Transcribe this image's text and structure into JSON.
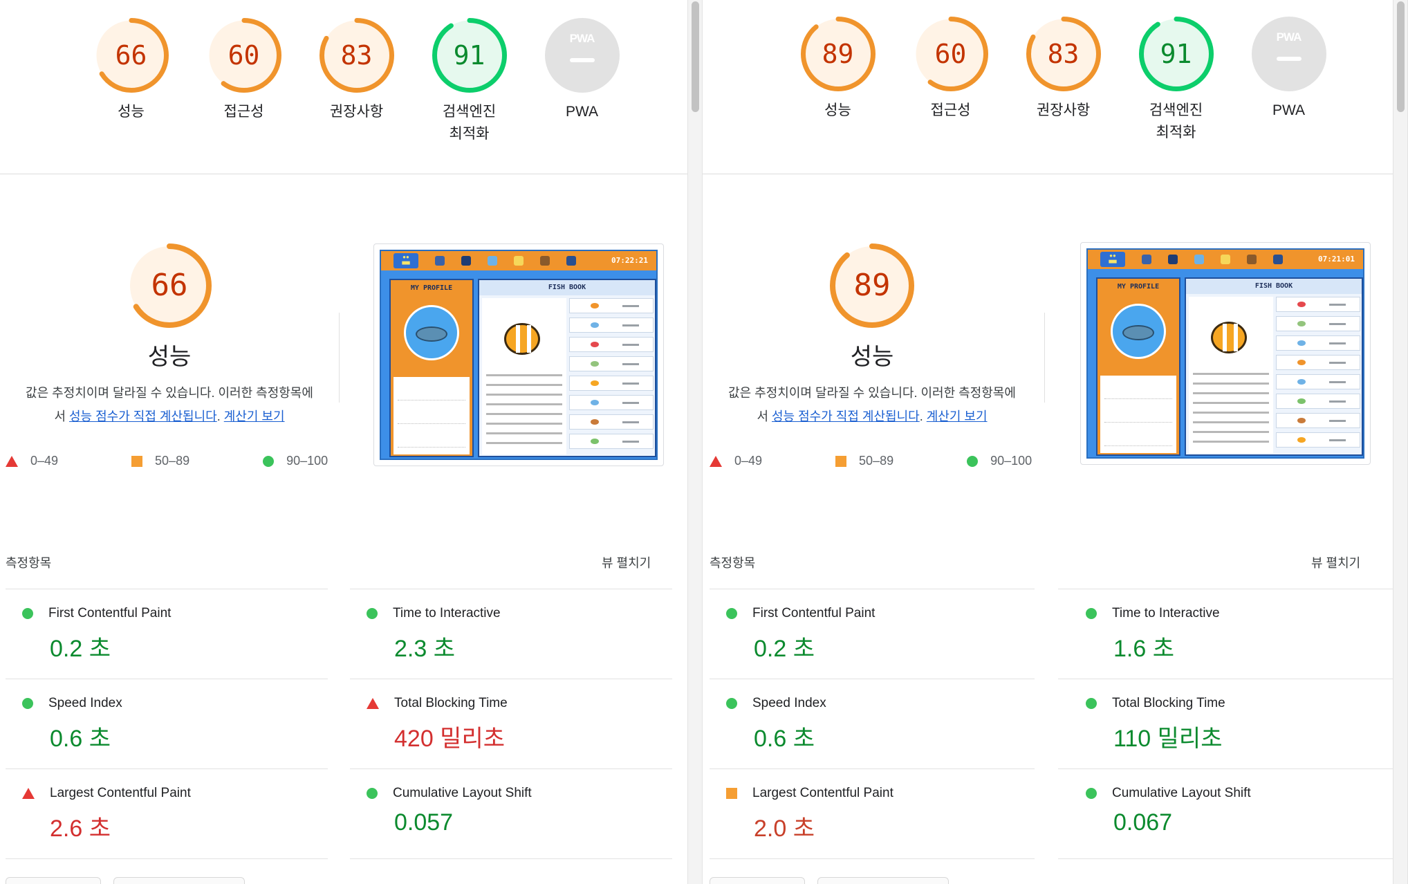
{
  "colors": {
    "orange": "#f0942c",
    "orange_text": "#c33300",
    "green": "#0cce6b",
    "green_text": "#0b8a2e",
    "red": "#e53935",
    "pwa_gray": "#e2e2e2",
    "link": "#1a5fd1"
  },
  "legend": {
    "fail": "0–49",
    "average": "50–89",
    "pass": "90–100"
  },
  "reports": [
    {
      "id": "before",
      "categories": [
        {
          "label": "성능",
          "score": 66
        },
        {
          "label": "접근성",
          "score": 60
        },
        {
          "label": "권장사항",
          "score": 83
        },
        {
          "label": "검색엔진",
          "label2": "최적화",
          "score": 91
        },
        {
          "label": "PWA",
          "score": null,
          "badge": "PWA"
        }
      ],
      "perf_score": 66,
      "perf_title": "성능",
      "desc_line1": "값은 추정치이며 달라질 수 있습니다. 이러한 측정항목에",
      "desc_prefix": "서 ",
      "desc_link1": "성능 점수가 직접 계산됩니다",
      "desc_sep": ". ",
      "desc_link2": "계산기 보기",
      "app_clock": "07:22:21",
      "app_profile_title": "MY PROFILE",
      "app_book_title": "FISH BOOK",
      "metrics_header": "측정항목",
      "metrics_toggle": "뷰 펼치기",
      "metrics": [
        {
          "name": "First Contentful Paint",
          "value": "0.2 초",
          "status": "pass"
        },
        {
          "name": "Time to Interactive",
          "value": "2.3 초",
          "status": "pass"
        },
        {
          "name": "Speed Index",
          "value": "0.6 초",
          "status": "pass"
        },
        {
          "name": "Total Blocking Time",
          "value": "420 밀리초",
          "status": "fail"
        },
        {
          "name": "Largest Contentful Paint",
          "value": "2.6 초",
          "status": "fail"
        },
        {
          "name": "Cumulative Layout Shift",
          "value": "0.057",
          "status": "pass"
        }
      ]
    },
    {
      "id": "after",
      "categories": [
        {
          "label": "성능",
          "score": 89
        },
        {
          "label": "접근성",
          "score": 60
        },
        {
          "label": "권장사항",
          "score": 83
        },
        {
          "label": "검색엔진",
          "label2": "최적화",
          "score": 91
        },
        {
          "label": "PWA",
          "score": null,
          "badge": "PWA"
        }
      ],
      "perf_score": 89,
      "perf_title": "성능",
      "desc_line1": "값은 추정치이며 달라질 수 있습니다. 이러한 측정항목에",
      "desc_prefix": "서 ",
      "desc_link1": "성능 점수가 직접 계산됩니다",
      "desc_sep": ". ",
      "desc_link2": "계산기 보기",
      "app_clock": "07:21:01",
      "app_profile_title": "MY PROFILE",
      "app_book_title": "FISH BOOK",
      "metrics_header": "측정항목",
      "metrics_toggle": "뷰 펼치기",
      "metrics": [
        {
          "name": "First Contentful Paint",
          "value": "0.2 초",
          "status": "pass"
        },
        {
          "name": "Time to Interactive",
          "value": "1.6 초",
          "status": "pass"
        },
        {
          "name": "Speed Index",
          "value": "0.6 초",
          "status": "pass"
        },
        {
          "name": "Total Blocking Time",
          "value": "110 밀리초",
          "status": "pass"
        },
        {
          "name": "Largest Contentful Paint",
          "value": "2.0 초",
          "status": "average"
        },
        {
          "name": "Cumulative Layout Shift",
          "value": "0.067",
          "status": "pass"
        }
      ]
    }
  ]
}
